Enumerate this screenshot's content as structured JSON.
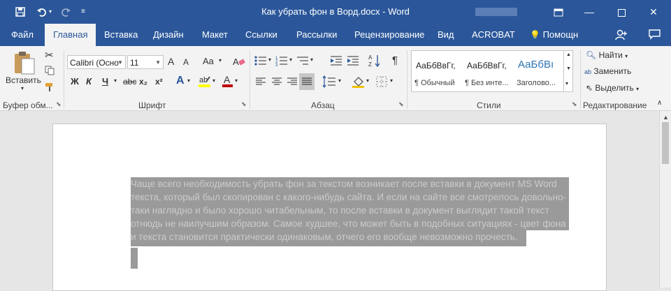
{
  "titlebar": {
    "title": "Как убрать фон в Ворд.docx - Word",
    "qat": {
      "save_icon": "save-icon",
      "undo_icon": "undo-icon",
      "redo_icon": "redo-icon",
      "customize_icon": "customize-qat-icon"
    },
    "controls": {
      "ribbon_display": "ribbon-display-options-icon",
      "minimize": "minimize-icon",
      "restore": "restore-icon",
      "close": "close-icon"
    }
  },
  "tabs": [
    "Файл",
    "Главная",
    "Вставка",
    "Дизайн",
    "Макет",
    "Ссылки",
    "Рассылки",
    "Рецензирование",
    "Вид",
    "ACROBAT",
    "Помощн"
  ],
  "active_tab": "Главная",
  "ribbon": {
    "clipboard": {
      "label": "Буфер обм...",
      "paste": "Вставить",
      "paste_dd": "▾"
    },
    "font": {
      "label": "Шрифт",
      "font_name": "Calibri (Осно",
      "font_size": "11",
      "grow": "A",
      "shrink": "A",
      "case": "Aa",
      "bold": "Ж",
      "italic": "К",
      "underline": "Ч",
      "strike": "abc",
      "sub": "x₂",
      "sup": "x²"
    },
    "paragraph": {
      "label": "Абзац",
      "pilcrow": "¶"
    },
    "styles": {
      "label": "Стили",
      "items": [
        {
          "preview": "АаБбВвГг,",
          "name": "¶ Обычный"
        },
        {
          "preview": "АаБбВвГг,",
          "name": "¶ Без инте..."
        },
        {
          "preview": "АаБбВı",
          "name": "Заголово..."
        }
      ]
    },
    "editing": {
      "label": "Редактирование",
      "find": "Найти",
      "replace": "Заменить",
      "select": "Выделить"
    }
  },
  "help_label": "Помощн",
  "document": {
    "lines": [
      "Чаще всего необходимость убрать фон за текстом возникает после вставки в документ MS Word",
      "текста, который был скопирован с какого-нибудь сайта. И если на сайте все смотрелось довольно-",
      "таки наглядно и было хорошо читабельным, то после вставки в документ выглядит такой текст",
      "отнюдь не наилучшим образом. Самое худшее, что может быть в подобных ситуациях - цвет фона",
      "и текста становится практически одинаковым, отчего его вообще невозможно прочесть."
    ],
    "highlight_color": "#9a9a9a",
    "text_color": "#cbcbcb"
  },
  "colors": {
    "accent": "#2b579a",
    "ribbon_bg": "#f3f3f3"
  }
}
